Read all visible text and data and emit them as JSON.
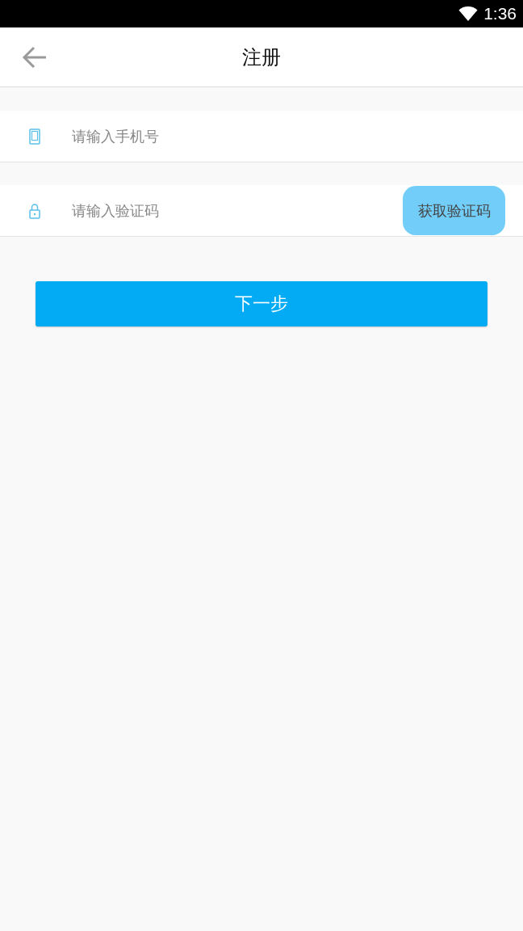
{
  "status_bar": {
    "time": "1:36"
  },
  "header": {
    "title": "注册"
  },
  "fields": [
    {
      "kind": "phone",
      "placeholder": "请输入手机号"
    },
    {
      "kind": "lock",
      "placeholder": "请输入验证码",
      "button": "获取验证码"
    }
  ],
  "next_button": "下一步"
}
